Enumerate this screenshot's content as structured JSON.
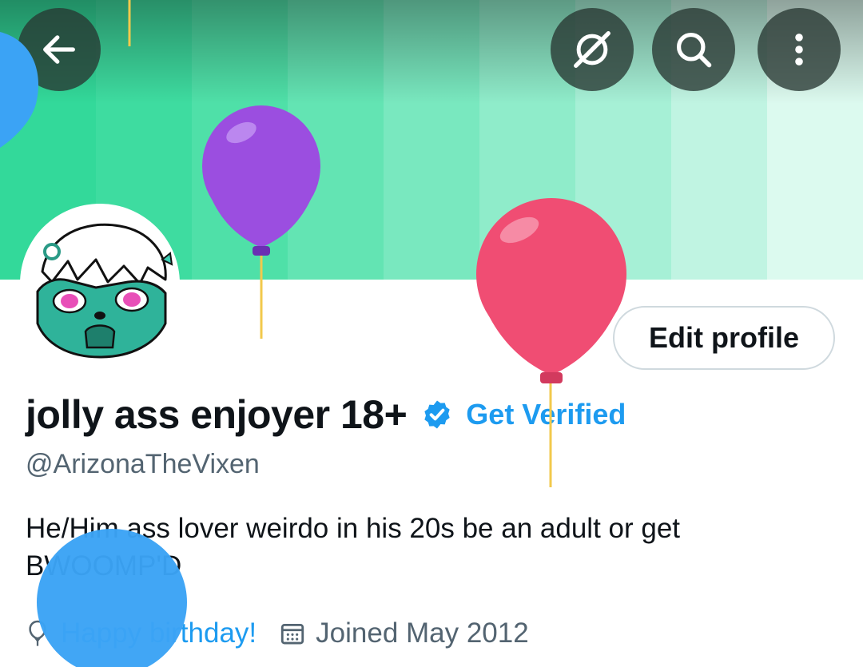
{
  "banner": {
    "stripe_colors": [
      "#33d99a",
      "#3edca0",
      "#4fe0a8",
      "#63e4b3",
      "#79e8bf",
      "#8fecca",
      "#a6f0d6",
      "#c0f4e2",
      "#dcfaef"
    ]
  },
  "topbar": {
    "back_icon": "arrow-left-icon",
    "grok_icon": "grok-icon",
    "search_icon": "search-icon",
    "more_icon": "more-vertical-icon"
  },
  "profile": {
    "edit_label": "Edit profile",
    "display_name": "jolly ass enjoyer 18+",
    "verified_icon": "verified-badge-icon",
    "get_verified_label": "Get Verified",
    "handle": "@ArizonaTheVixen",
    "bio": "He/Him ass lover weirdo in his 20s be an adult or get BWOOMP'D",
    "birthday_label": "Happy birthday!",
    "joined_label": "Joined May 2012"
  },
  "colors": {
    "accent": "#1d9bf0",
    "secondary_text": "#536471",
    "balloon_purple": "#9b4ee0",
    "balloon_red": "#f04d73",
    "balloon_blue": "#3ba3f5"
  }
}
